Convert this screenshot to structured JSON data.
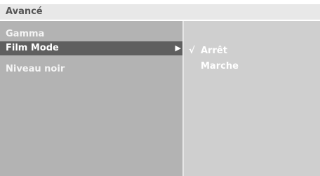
{
  "title": "Avancé",
  "menu": {
    "items": [
      {
        "label": "Gamma",
        "selected": false
      },
      {
        "label": "Film Mode",
        "selected": true,
        "has_submenu": true
      },
      {
        "label": "Niveau noir",
        "selected": false
      }
    ]
  },
  "submenu": {
    "check_mark": "√",
    "options": [
      {
        "label": "Arrêt",
        "checked": true
      },
      {
        "label": "Marche",
        "checked": false
      }
    ]
  },
  "colors": {
    "title_bg": "#e8e8e8",
    "left_panel_bg": "#b3b3b3",
    "right_panel_bg": "#cfcfcf",
    "selected_bg": "#5f5f5f",
    "text": "#ffffff"
  }
}
